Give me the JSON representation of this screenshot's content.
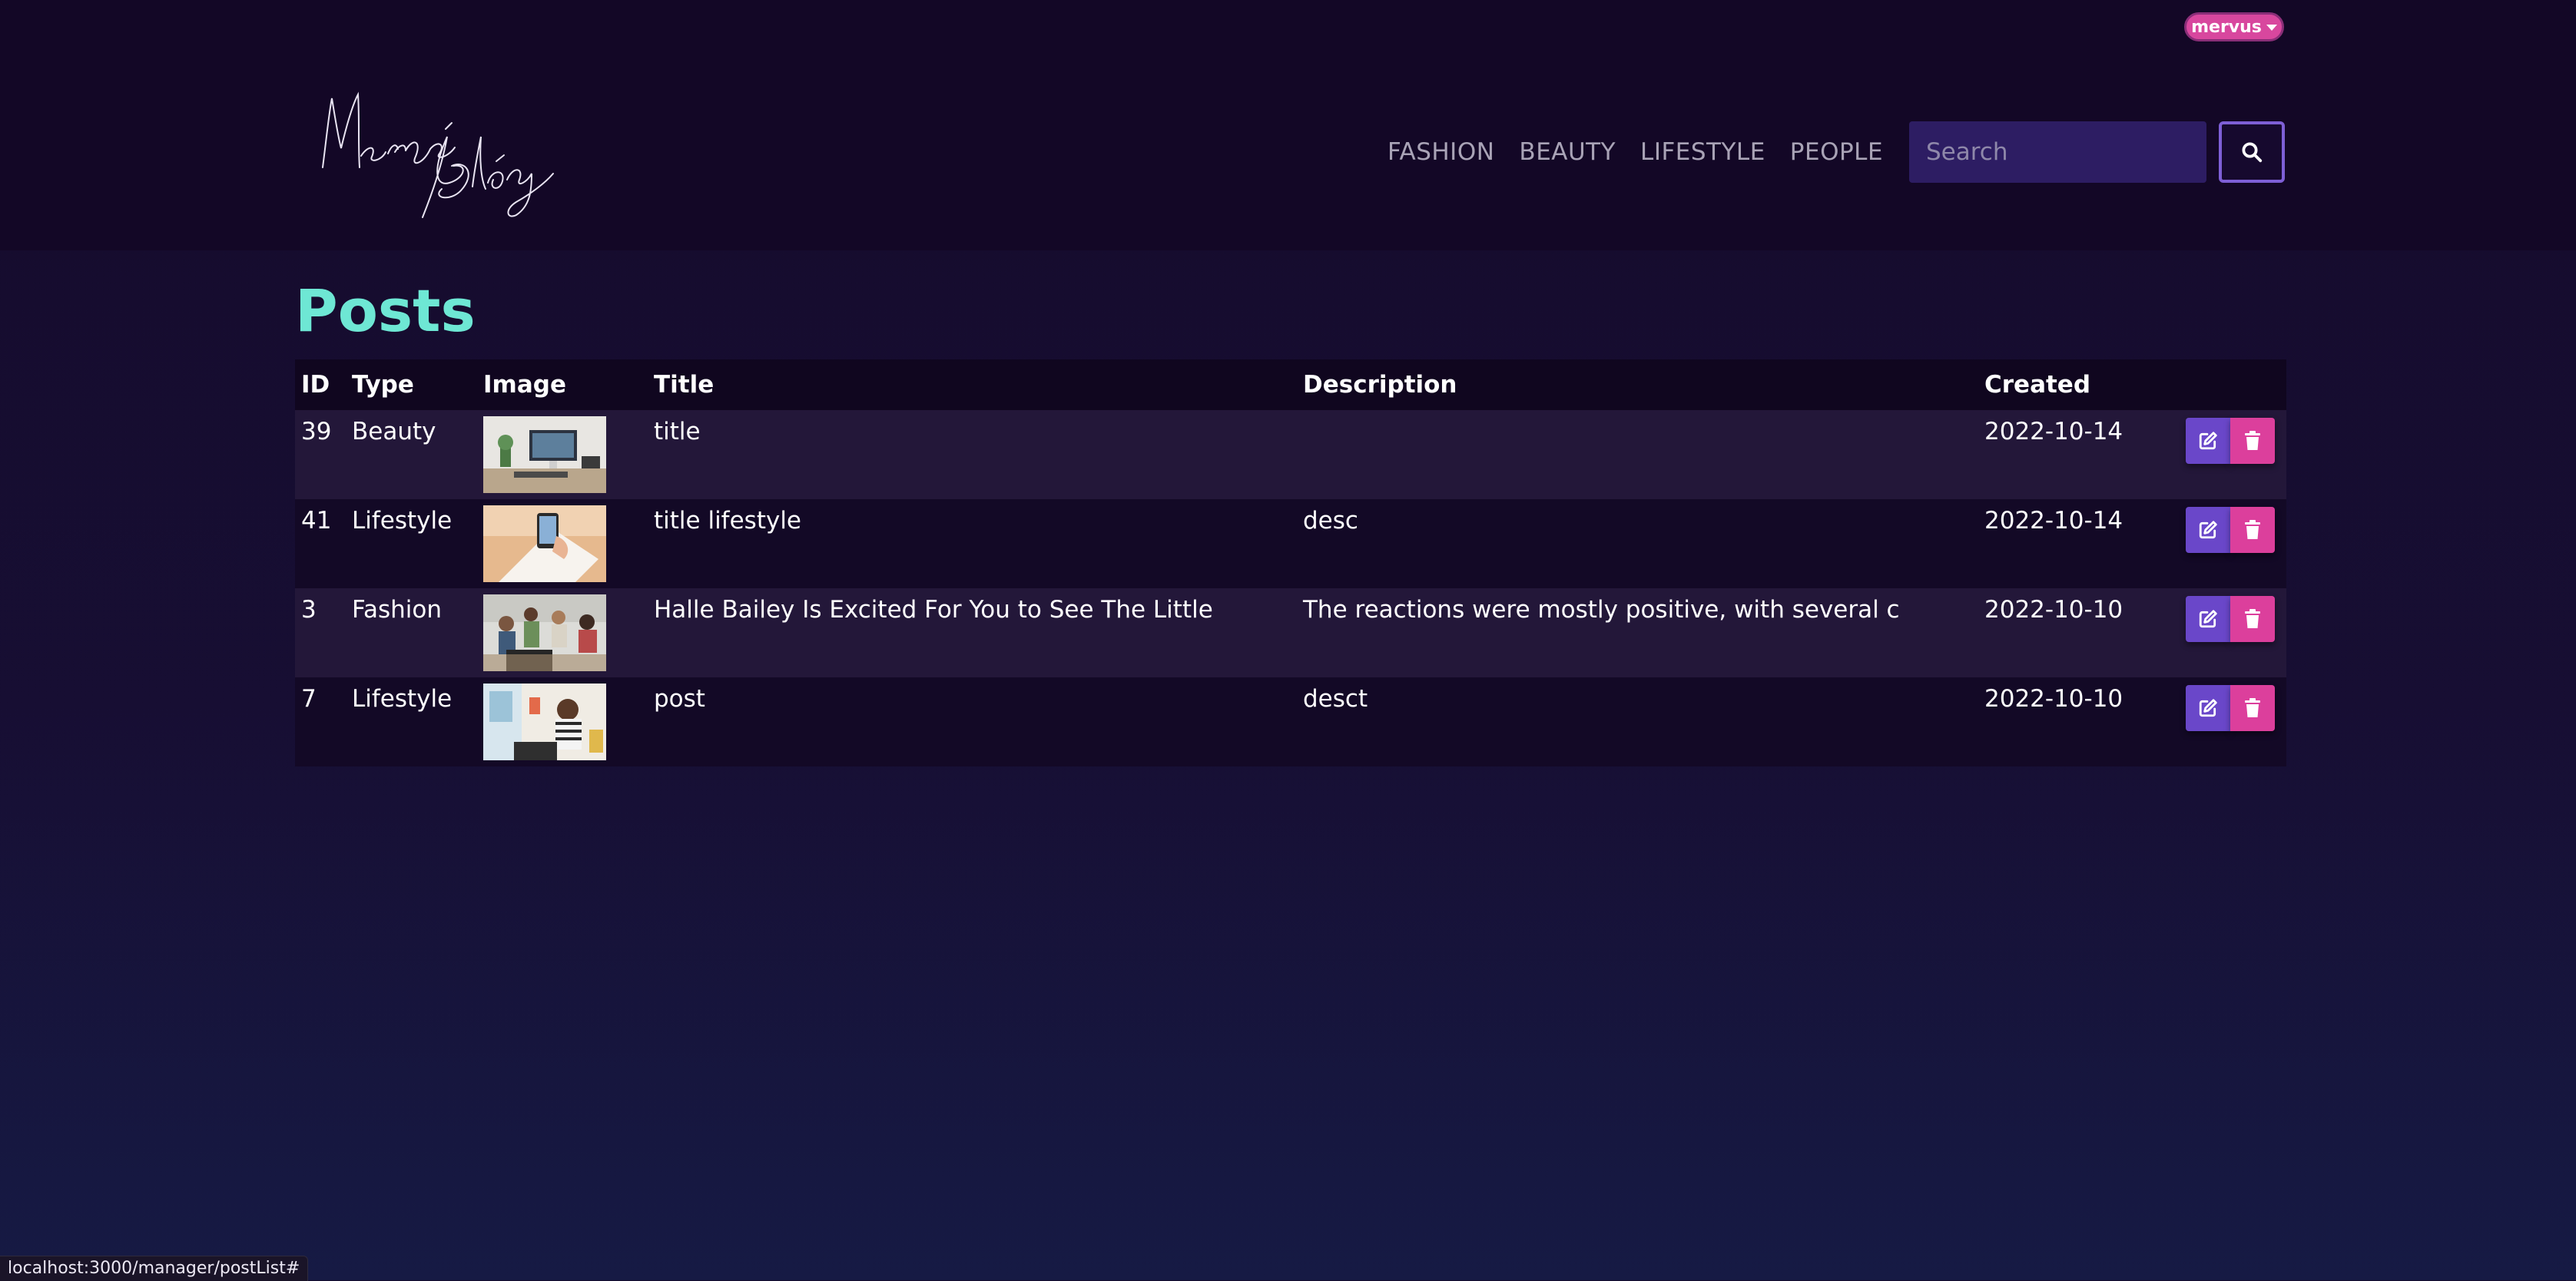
{
  "header": {
    "user_label": "mervus",
    "nav": [
      "FASHION",
      "BEAUTY",
      "LIFESTYLE",
      "PEOPLE"
    ],
    "search_placeholder": "Search",
    "logo_text": "Merve Blog"
  },
  "page": {
    "title": "Posts"
  },
  "table": {
    "columns": [
      "ID",
      "Type",
      "Image",
      "Title",
      "Description",
      "Created"
    ],
    "rows": [
      {
        "id": "39",
        "type": "Beauty",
        "image": "desk-computer-photo",
        "title": "title",
        "description": "",
        "created": "2022-10-14"
      },
      {
        "id": "41",
        "type": "Lifestyle",
        "image": "hand-phone-photo",
        "title": "title lifestyle",
        "description": "desc",
        "created": "2022-10-14"
      },
      {
        "id": "3",
        "type": "Fashion",
        "image": "team-meeting-photo",
        "title": "Halle Bailey Is Excited For You to See The Little",
        "description": "The reactions were mostly positive, with several c",
        "created": "2022-10-10"
      },
      {
        "id": "7",
        "type": "Lifestyle",
        "image": "woman-at-laptop-photo",
        "title": "post",
        "description": "desct",
        "created": "2022-10-10"
      }
    ]
  },
  "status_bar": {
    "url": "localhost:3000/manager/postList#"
  },
  "colors": {
    "accent_teal": "#6ee7d4",
    "edit_purple": "#6a47c9",
    "delete_pink": "#dc3f9c",
    "user_pill": "#d8479e"
  }
}
